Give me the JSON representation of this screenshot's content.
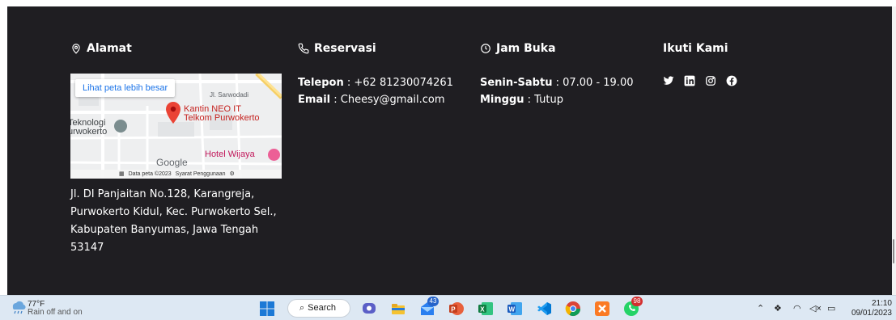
{
  "alamat": {
    "heading": "Alamat",
    "map": {
      "link_label": "Lihat peta lebih besar",
      "street_label": "Jl. Sarwodadi",
      "place_line1": "Kantin NEO IT",
      "place_line2": "Telkom Purwokerto",
      "nearby_line1": "Teknologi",
      "nearby_line2": "urwokerto",
      "google_label": "Google",
      "hotel_label": "Hotel Wijaya",
      "data_label": "Data peta ©2023",
      "terms_label": "Syarat Penggunaan"
    },
    "address_lines": [
      "Jl. DI Panjaitan No.128, Karangreja,",
      "Purwokerto Kidul, Kec. Purwokerto Sel.,",
      "Kabupaten Banyumas, Jawa Tengah",
      "53147"
    ]
  },
  "reservasi": {
    "heading": "Reservasi",
    "phone_label": "Telepon",
    "phone_value": " : +62 81230074261",
    "email_label": "Email",
    "email_value": " : Cheesy@gmail.com"
  },
  "jam_buka": {
    "heading": "Jam Buka",
    "weekday_label": "Senin-Sabtu",
    "weekday_value": " : 07.00 - 19.00",
    "sunday_label": "Minggu",
    "sunday_value": " : Tutup"
  },
  "ikuti_kami": {
    "heading": "Ikuti Kami",
    "icons": [
      "twitter-icon",
      "linkedin-icon",
      "instagram-icon",
      "facebook-icon"
    ]
  },
  "taskbar": {
    "weather_temp": "77°F",
    "weather_desc": "Rain off and on",
    "search_label": "Search",
    "mail_badge": "43",
    "whatsapp_badge": "98",
    "time": "21:10",
    "date": "09/01/2023"
  },
  "colors": {
    "footer_bg": "#1f1e22",
    "taskbar_bg": "#dde8f3",
    "map_pin": "#ea4335"
  }
}
